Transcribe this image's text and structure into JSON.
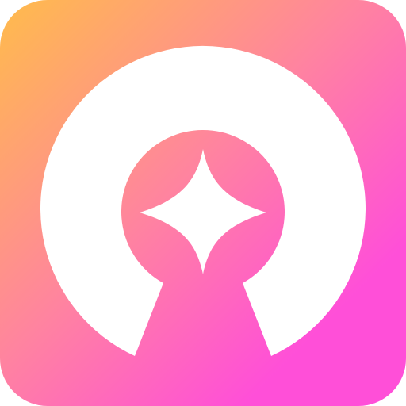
{
  "icon": {
    "name": "keyhole-sparkle-app-icon",
    "gradient": {
      "start_color": "#FFBC4B",
      "mid_color": "#FF83A0",
      "end_color": "#FF4FD8"
    },
    "glyph_color": "#FFFFFF"
  }
}
